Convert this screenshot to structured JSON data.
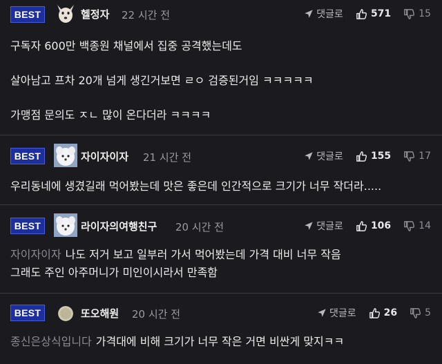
{
  "comments": [
    {
      "badge": "BEST",
      "nickname": "헬정자",
      "time": "22 시간 전",
      "reply_label": "댓글로",
      "likes": "571",
      "dislikes": "15",
      "lines": [
        "구독자 600만 백종원 채널에서 집중 공격했는데도",
        "살아남고 프차 20개 넘게 생긴거보면 ㄹㅇ 검증된거임 ㅋㅋㅋㅋㅋ",
        "가맹점 문의도 ㅈㄴ 많이 온다더라 ㅋㅋㅋㅋ"
      ]
    },
    {
      "badge": "BEST",
      "nickname": "자이자이자",
      "time": "21 시간 전",
      "reply_label": "댓글로",
      "likes": "155",
      "dislikes": "17",
      "lines": [
        "우리동네에 생겼길래 먹어봤는데 맛은 좋은데 인간적으로 크기가 너무 작더라....."
      ]
    },
    {
      "badge": "BEST",
      "nickname": "라이자의여행친구",
      "time": "20 시간 전",
      "reply_label": "댓글로",
      "likes": "106",
      "dislikes": "14",
      "mention": "자이자이자",
      "lines": [
        "나도 저거 보고 일부러 가서 먹어봤는데 가격 대비 너무 작음",
        "그래도 주인 아주머니가 미인이시라서 만족함"
      ]
    },
    {
      "badge": "BEST",
      "nickname": "또오해원",
      "time": "20 시간 전",
      "reply_label": "댓글로",
      "likes": "26",
      "dislikes": "5",
      "mention": "종신은상식입니다",
      "lines": [
        "가격대에 비해 크기가 너무 작은 거면 비싼게 맞지ㅋㅋ"
      ]
    }
  ],
  "icons": {
    "reply": "reply-arrow-icon",
    "like": "thumbs-up-icon",
    "dislike": "thumbs-down-icon"
  },
  "colors": {
    "background": "#1b1b1f",
    "best_badge": "#1d2f9c",
    "divider": "#3a3a40"
  }
}
